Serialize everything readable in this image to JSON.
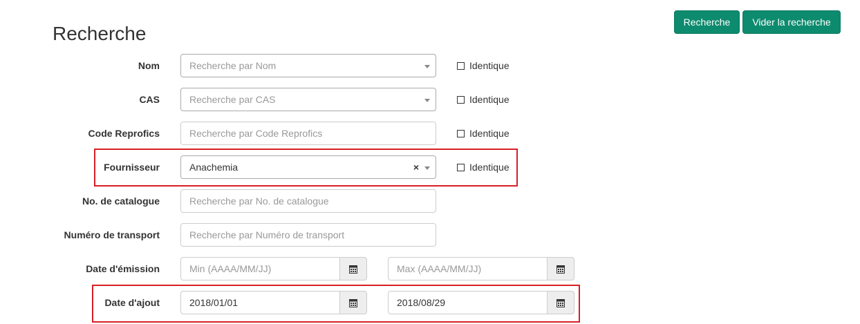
{
  "header": {
    "title": "Recherche",
    "search_button": "Recherche",
    "clear_button": "Vider la recherche"
  },
  "form": {
    "nom": {
      "label": "Nom",
      "placeholder": "Recherche par Nom",
      "identique": "Identique"
    },
    "cas": {
      "label": "CAS",
      "placeholder": "Recherche par CAS",
      "identique": "Identique"
    },
    "reprofics": {
      "label": "Code Reprofics",
      "placeholder": "Recherche par Code Reprofics",
      "identique": "Identique"
    },
    "fournisseur": {
      "label": "Fournisseur",
      "value": "Anachemia",
      "clear_glyph": "×",
      "identique": "Identique"
    },
    "catalogue": {
      "label": "No. de catalogue",
      "placeholder": "Recherche par No. de catalogue"
    },
    "transport": {
      "label": "Numéro de transport",
      "placeholder": "Recherche par Numéro de transport"
    },
    "emission": {
      "label": "Date d'émission",
      "min_placeholder": "Min (AAAA/MM/JJ)",
      "max_placeholder": "Max (AAAA/MM/JJ)"
    },
    "ajout": {
      "label": "Date d'ajout",
      "min_value": "2018/01/01",
      "max_value": "2018/08/29"
    }
  },
  "colors": {
    "button_bg": "#0d8b6e",
    "highlight": "#d61f26"
  },
  "icons": {
    "dropdown": "caret-down-icon",
    "calendar": "calendar-icon",
    "clear": "clear-icon"
  }
}
